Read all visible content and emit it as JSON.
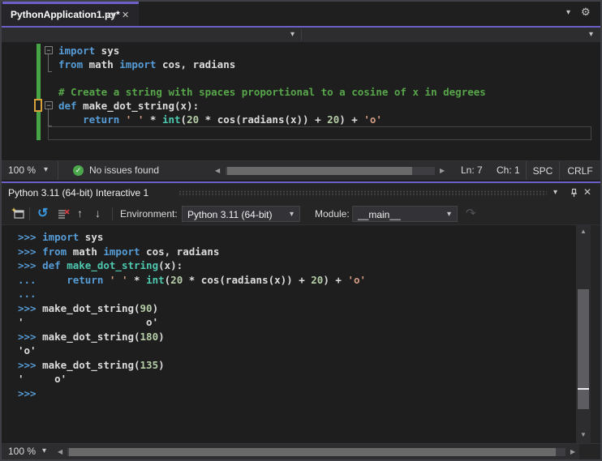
{
  "colors": {
    "accent_purple": "#6C5FC7",
    "keyword_blue": "#569CD6",
    "string_orange": "#D69D85",
    "number_green": "#B5CEA8",
    "comment_green": "#57A64A",
    "type_teal": "#4EC9B0",
    "change_bar_green": "#47A447",
    "change_bar_orange": "#D7A139",
    "check_green": "#4CA64C"
  },
  "icons": {
    "chevron": "▾",
    "gear": "⚙",
    "close": "✕",
    "check": "✓",
    "restart": "↺",
    "up": "↑",
    "down": "↓",
    "redo": "↷",
    "left": "◀",
    "right": "▶",
    "sb_up": "▲",
    "sb_down": "▼",
    "minus": "−"
  },
  "tab": {
    "title": "PythonApplication1.py*"
  },
  "editor": {
    "zoom": "100 %",
    "status": {
      "issues": "No issues found",
      "line": "Ln: 7",
      "col": "Ch: 1",
      "spaces": "SPC",
      "eol": "CRLF"
    },
    "lines": [
      [
        [
          "kw",
          "import"
        ],
        [
          "pl",
          " sys"
        ]
      ],
      [
        [
          "kw",
          "from"
        ],
        [
          "pl",
          " math "
        ],
        [
          "kw",
          "import"
        ],
        [
          "pl",
          " cos, radians"
        ]
      ],
      [],
      [
        [
          "com",
          "# Create a string with spaces proportional to a cosine of x in degrees"
        ]
      ],
      [
        [
          "kw",
          "def"
        ],
        [
          "pl",
          " make_dot_string(x):"
        ]
      ],
      [
        [
          "pl",
          "    "
        ],
        [
          "kw",
          "return"
        ],
        [
          "pl",
          " "
        ],
        [
          "str",
          "' '"
        ],
        [
          "pl",
          " * "
        ],
        [
          "fn",
          "int"
        ],
        [
          "pl",
          "("
        ],
        [
          "num",
          "20"
        ],
        [
          "pl",
          " * cos(radians(x)) + "
        ],
        [
          "num",
          "20"
        ],
        [
          "pl",
          ") + "
        ],
        [
          "str",
          "'o'"
        ]
      ],
      []
    ]
  },
  "repl": {
    "title": "Python 3.11 (64-bit) Interactive 1",
    "zoom": "100 %",
    "toolbar": {
      "environment_label": "Environment:",
      "environment_value": "Python 3.11 (64-bit)",
      "module_label": "Module:",
      "module_value": "__main__"
    },
    "lines": [
      [
        [
          "pr",
          ">>> "
        ],
        [
          "kw",
          "import"
        ],
        [
          "pl",
          " sys"
        ]
      ],
      [
        [
          "pr",
          ">>> "
        ],
        [
          "kw",
          "from"
        ],
        [
          "pl",
          " math "
        ],
        [
          "kw",
          "import"
        ],
        [
          "pl",
          " cos, radians"
        ]
      ],
      [
        [
          "pr",
          ">>> "
        ],
        [
          "kw",
          "def"
        ],
        [
          "pl",
          " "
        ],
        [
          "fn",
          "make_dot_string"
        ],
        [
          "pl",
          "(x):"
        ]
      ],
      [
        [
          "pr",
          "... "
        ],
        [
          "pl",
          "    "
        ],
        [
          "kw",
          "return"
        ],
        [
          "pl",
          " "
        ],
        [
          "str",
          "' '"
        ],
        [
          "pl",
          " * "
        ],
        [
          "fn",
          "int"
        ],
        [
          "pl",
          "("
        ],
        [
          "num",
          "20"
        ],
        [
          "pl",
          " * cos(radians(x)) + "
        ],
        [
          "num",
          "20"
        ],
        [
          "pl",
          ") + "
        ],
        [
          "str",
          "'o'"
        ]
      ],
      [
        [
          "pr",
          "... "
        ]
      ],
      [
        [
          "pr",
          ">>> "
        ],
        [
          "pl",
          "make_dot_string("
        ],
        [
          "num",
          "90"
        ],
        [
          "pl",
          ")"
        ]
      ],
      [
        [
          "out",
          "'                    o'"
        ]
      ],
      [
        [
          "pr",
          ">>> "
        ],
        [
          "pl",
          "make_dot_string("
        ],
        [
          "num",
          "180"
        ],
        [
          "pl",
          ")"
        ]
      ],
      [
        [
          "out",
          "'o'"
        ]
      ],
      [
        [
          "pr",
          ">>> "
        ],
        [
          "pl",
          "make_dot_string("
        ],
        [
          "num",
          "135"
        ],
        [
          "pl",
          ")"
        ]
      ],
      [
        [
          "out",
          "'     o'"
        ]
      ],
      [
        [
          "pr",
          ">>> "
        ]
      ]
    ]
  }
}
